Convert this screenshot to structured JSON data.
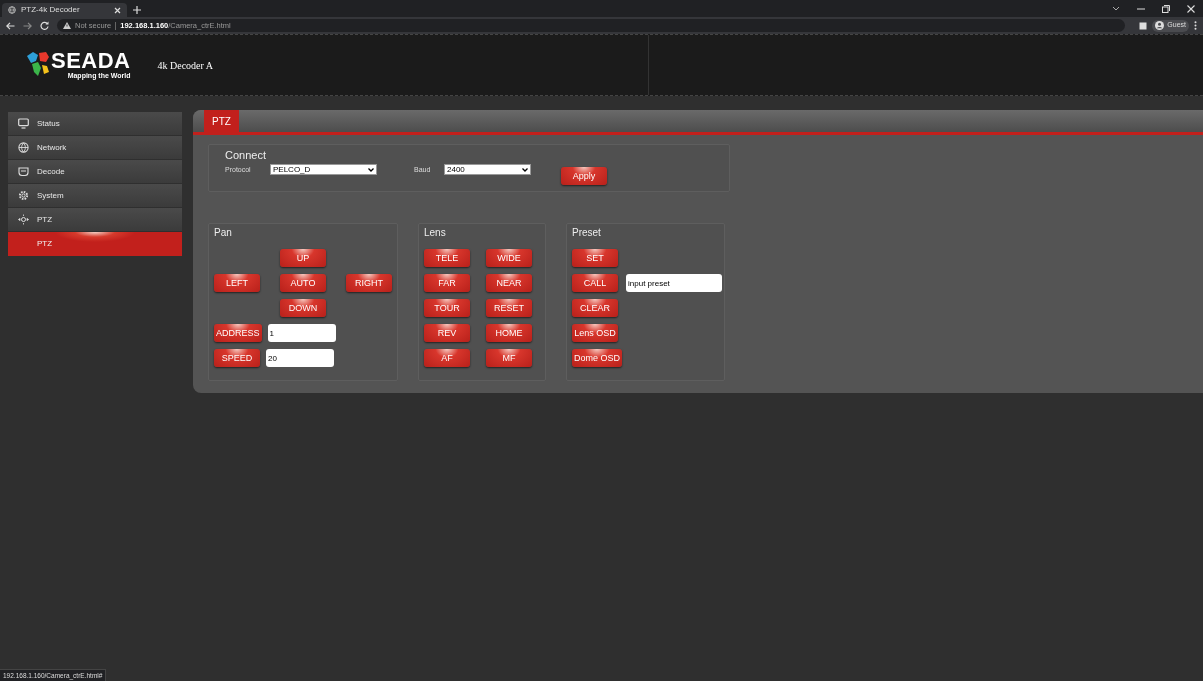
{
  "browser": {
    "tab_title": "PTZ-4k Decoder",
    "url_host": "192.168.1.160",
    "url_path": "/Camera_ctrE.html",
    "security": "Not secure",
    "profile": "Guest",
    "status_url": "192.168.1.160/Camera_ctrE.html#"
  },
  "header": {
    "brand": "SEADA",
    "tagline": "Mapping the World",
    "device": "4k Decoder A"
  },
  "sidebar": {
    "items": [
      {
        "label": "Status",
        "selected": false
      },
      {
        "label": "Network",
        "selected": false
      },
      {
        "label": "Decode",
        "selected": false
      },
      {
        "label": "System",
        "selected": false
      },
      {
        "label": "PTZ",
        "selected": false,
        "children": [
          {
            "label": "PTZ",
            "selected": true
          }
        ]
      }
    ]
  },
  "tabs": [
    {
      "label": "PTZ",
      "selected": true
    }
  ],
  "connect": {
    "title": "Connect",
    "fields": [
      {
        "label": "Protocol",
        "value": "PELCO_D"
      },
      {
        "label": "Baud",
        "value": "2400"
      }
    ],
    "apply": "Apply"
  },
  "pan": {
    "title": "Pan",
    "directions": {
      "up": "UP",
      "left": "LEFT",
      "auto": "AUTO",
      "right": "RIGHT",
      "down": "DOWN"
    },
    "fields": [
      {
        "button": "ADDRESS",
        "value": "1"
      },
      {
        "button": "SPEED",
        "value": "20"
      }
    ]
  },
  "lens": {
    "title": "Lens",
    "buttons": [
      "TELE",
      "WIDE",
      "FAR",
      "NEAR",
      "TOUR",
      "RESET",
      "REV",
      "HOME",
      "AF",
      "MF"
    ]
  },
  "preset": {
    "title": "Preset",
    "buttons": [
      {
        "label": "SET"
      },
      {
        "label": "CALL",
        "input": {
          "value": "input preset"
        }
      },
      {
        "label": "CLEAR"
      },
      {
        "label": "Lens OSD"
      },
      {
        "label": "Dome OSD"
      }
    ]
  }
}
